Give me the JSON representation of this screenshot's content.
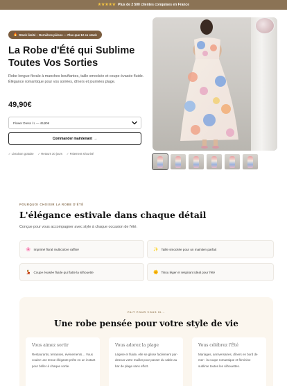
{
  "announcement": {
    "stars": "★★★★★",
    "text": "Plus de 2 500 clientes conquises en France"
  },
  "product": {
    "badge_icon": "🔥",
    "badge": "Stock limité – Dernières pièces — Plus que 12 en stock",
    "title": "La Robe d'Été qui Sublime Toutes Vos Sorties",
    "description": "Robe longue florale à manches bouffantes, taille smockée et coupe évasée fluide. Élégance romantique pour vos soirées, dîners et journées plage.",
    "price": "49,90€",
    "variant_selected": "Flower Dress / L — 49,90€",
    "cta_label": "Commander maintenant",
    "cta_arrow": "→",
    "assurances": [
      "✓ Livraison gratuite",
      "✓ Retours 30 jours",
      "✓ Paiement sécurisé"
    ]
  },
  "section_details": {
    "eyebrow": "POURQUOI CHOISIR LA ROBE D'ÉTÉ",
    "heading": "L'élégance estivale dans chaque détail",
    "subheading": "Conçue pour vous accompagner avec style à chaque occasion de l'été.",
    "features": [
      {
        "icon": "🌸",
        "text": "Imprimé floral multicolore raffiné"
      },
      {
        "icon": "✨",
        "text": "Taille smockée pour un maintien parfait"
      },
      {
        "icon": "💃",
        "text": "Coupe évasée fluide qui flatte la silhouette"
      },
      {
        "icon": "🌞",
        "text": "Tissu léger et respirant idéal pour l'été"
      }
    ]
  },
  "section_style": {
    "eyebrow": "FAIT POUR VOUS SI...",
    "heading": "Une robe pensée pour votre style de vie",
    "cards": [
      {
        "title": "Vous aimez sortir",
        "body": "Restaurants, terrasses, événements… Vous voulez une tenue élégante prête en un instant pour briller à chaque sortie."
      },
      {
        "title": "Vous adorez la plage",
        "body": "Légère et fluide, elle se glisse facilement par-dessus votre maillot pour passer du sable au bar de plage sans effort."
      },
      {
        "title": "Vous célébrez l'Été",
        "body": "Mariages, anniversaires, dîners en bord de mer : la coupe romantique et féminine sublime toutes les silhouettes."
      }
    ]
  },
  "colors": {
    "accent": "#8b7355",
    "badge_bg": "#7a5c3e",
    "panel_bg": "#fbf6ee"
  },
  "icons": {
    "dropdown": "chevron-down-icon",
    "feature": "checkmark-icon"
  }
}
